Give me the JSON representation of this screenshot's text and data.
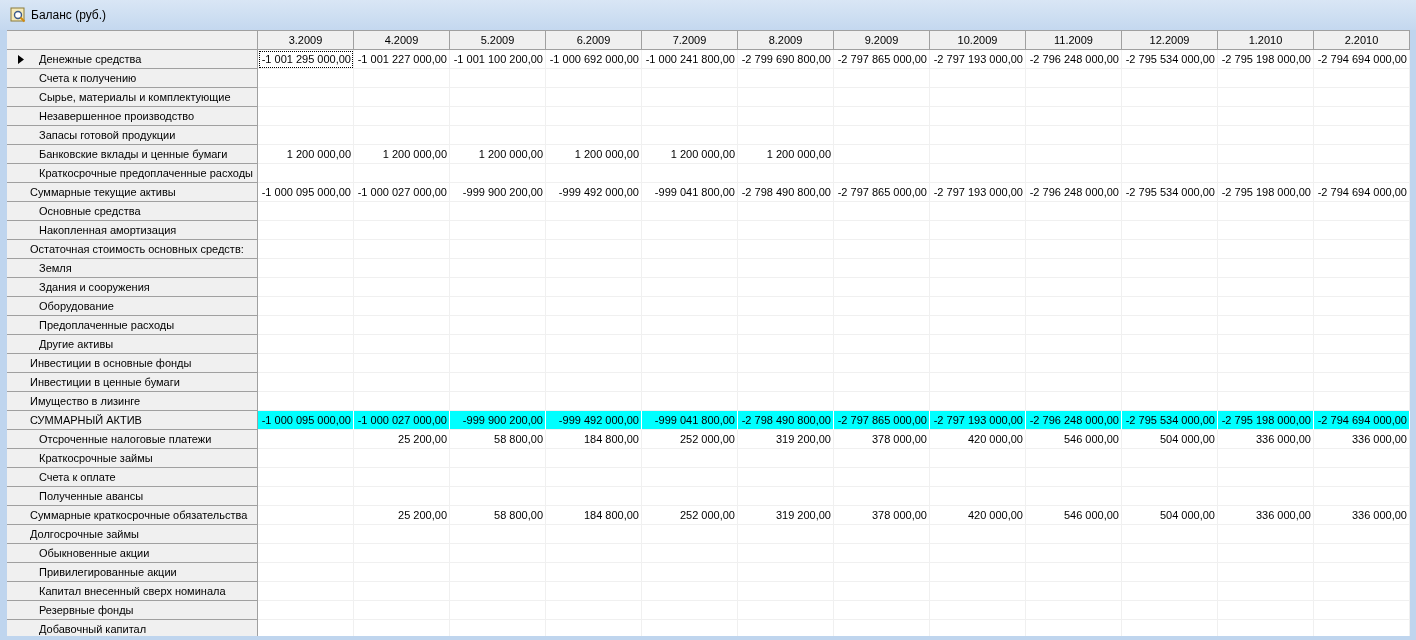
{
  "window": {
    "title": "Баланс (руб.)"
  },
  "table": {
    "columns": [
      "3.2009",
      "4.2009",
      "5.2009",
      "6.2009",
      "7.2009",
      "8.2009",
      "9.2009",
      "10.2009",
      "11.2009",
      "12.2009",
      "1.2010",
      "2.2010"
    ],
    "rows": [
      {
        "label": "Денежные средства",
        "kind": "detail",
        "selected": true,
        "highlighted": false,
        "values": {
          "0": "-1 001 295 000,00",
          "1": "-1 001 227 000,00",
          "2": "-1 001 100 200,00",
          "3": "-1 000 692 000,00",
          "4": "-1 000 241 800,00",
          "5": "-2 799 690 800,00",
          "6": "-2 797 865 000,00",
          "7": "-2 797 193 000,00",
          "8": "-2 796 248 000,00",
          "9": "-2 795 534 000,00",
          "10": "-2 795 198 000,00",
          "11": "-2 794 694 000,00"
        }
      },
      {
        "label": "Счета к получению",
        "kind": "detail",
        "selected": false,
        "highlighted": false
      },
      {
        "label": "Сырье, материалы и комплектующие",
        "kind": "detail",
        "selected": false,
        "highlighted": false
      },
      {
        "label": "Незавершенное производство",
        "kind": "detail",
        "selected": false,
        "highlighted": false
      },
      {
        "label": "Запасы готовой продукции",
        "kind": "detail",
        "selected": false,
        "highlighted": false
      },
      {
        "label": "Банковские вклады и ценные бумаги",
        "kind": "detail",
        "selected": false,
        "highlighted": false,
        "values": {
          "0": "1 200 000,00",
          "1": "1 200 000,00",
          "2": "1 200 000,00",
          "3": "1 200 000,00",
          "4": "1 200 000,00",
          "5": "1 200 000,00"
        }
      },
      {
        "label": "Краткосрочные предоплаченные расходы",
        "kind": "detail",
        "selected": false,
        "highlighted": false
      },
      {
        "label": "Суммарные текущие активы",
        "kind": "summary",
        "selected": false,
        "highlighted": false,
        "values": {
          "0": "-1 000 095 000,00",
          "1": "-1 000 027 000,00",
          "2": "-999 900 200,00",
          "3": "-999 492 000,00",
          "4": "-999 041 800,00",
          "5": "-2 798 490 800,00",
          "6": "-2 797 865 000,00",
          "7": "-2 797 193 000,00",
          "8": "-2 796 248 000,00",
          "9": "-2 795 534 000,00",
          "10": "-2 795 198 000,00",
          "11": "-2 794 694 000,00"
        }
      },
      {
        "label": "Основные средства",
        "kind": "detail",
        "selected": false,
        "highlighted": false
      },
      {
        "label": "Накопленная амортизация",
        "kind": "detail",
        "selected": false,
        "highlighted": false
      },
      {
        "label": "Остаточная стоимость основных средств:",
        "kind": "summary",
        "selected": false,
        "highlighted": false
      },
      {
        "label": "Земля",
        "kind": "detail",
        "selected": false,
        "highlighted": false
      },
      {
        "label": "Здания и сооружения",
        "kind": "detail",
        "selected": false,
        "highlighted": false
      },
      {
        "label": "Оборудование",
        "kind": "detail",
        "selected": false,
        "highlighted": false
      },
      {
        "label": "Предоплаченные расходы",
        "kind": "detail",
        "selected": false,
        "highlighted": false
      },
      {
        "label": "Другие активы",
        "kind": "detail",
        "selected": false,
        "highlighted": false
      },
      {
        "label": "Инвестиции в основные фонды",
        "kind": "summary",
        "selected": false,
        "highlighted": false
      },
      {
        "label": "Инвестиции в ценные бумаги",
        "kind": "summary",
        "selected": false,
        "highlighted": false
      },
      {
        "label": "Имущество в лизинге",
        "kind": "summary",
        "selected": false,
        "highlighted": false
      },
      {
        "label": "СУММАРНЫЙ АКТИВ",
        "kind": "summary",
        "selected": false,
        "highlighted": true,
        "values": {
          "0": "-1 000 095 000,00",
          "1": "-1 000 027 000,00",
          "2": "-999 900 200,00",
          "3": "-999 492 000,00",
          "4": "-999 041 800,00",
          "5": "-2 798 490 800,00",
          "6": "-2 797 865 000,00",
          "7": "-2 797 193 000,00",
          "8": "-2 796 248 000,00",
          "9": "-2 795 534 000,00",
          "10": "-2 795 198 000,00",
          "11": "-2 794 694 000,00"
        }
      },
      {
        "label": "Отсроченные налоговые платежи",
        "kind": "detail",
        "selected": false,
        "highlighted": false,
        "values": {
          "1": "25 200,00",
          "2": "58 800,00",
          "3": "184 800,00",
          "4": "252 000,00",
          "5": "319 200,00",
          "6": "378 000,00",
          "7": "420 000,00",
          "8": "546 000,00",
          "9": "504 000,00",
          "10": "336 000,00",
          "11": "336 000,00"
        }
      },
      {
        "label": "Краткосрочные займы",
        "kind": "detail",
        "selected": false,
        "highlighted": false
      },
      {
        "label": "Счета к оплате",
        "kind": "detail",
        "selected": false,
        "highlighted": false
      },
      {
        "label": "Полученные авансы",
        "kind": "detail",
        "selected": false,
        "highlighted": false
      },
      {
        "label": "Суммарные краткосрочные обязательства",
        "kind": "summary",
        "selected": false,
        "highlighted": false,
        "values": {
          "1": "25 200,00",
          "2": "58 800,00",
          "3": "184 800,00",
          "4": "252 000,00",
          "5": "319 200,00",
          "6": "378 000,00",
          "7": "420 000,00",
          "8": "546 000,00",
          "9": "504 000,00",
          "10": "336 000,00",
          "11": "336 000,00"
        }
      },
      {
        "label": "Долгосрочные займы",
        "kind": "summary",
        "selected": false,
        "highlighted": false
      },
      {
        "label": "Обыкновенные акции",
        "kind": "detail",
        "selected": false,
        "highlighted": false
      },
      {
        "label": "Привилегированные акции",
        "kind": "detail",
        "selected": false,
        "highlighted": false
      },
      {
        "label": "Капитал внесенный сверх номинала",
        "kind": "detail",
        "selected": false,
        "highlighted": false
      },
      {
        "label": "Резервные фонды",
        "kind": "detail",
        "selected": false,
        "highlighted": false
      },
      {
        "label": "Добавочный капитал",
        "kind": "detail",
        "selected": false,
        "highlighted": false
      }
    ]
  }
}
